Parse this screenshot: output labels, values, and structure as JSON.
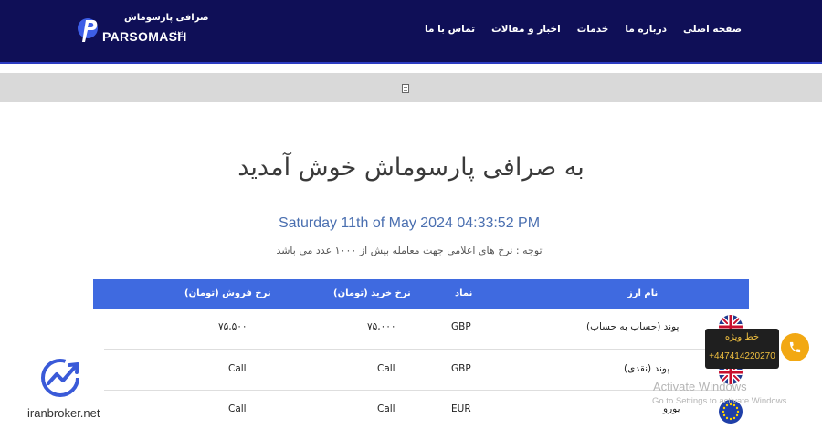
{
  "header": {
    "logo_sub": "صرافی پارسوماش",
    "logo_name": "PARSOMASH",
    "logo_tm": "Ltd",
    "nav": [
      "صفحه اصلی",
      "درباره ما",
      "خدمات",
      "اخبار و مقالات",
      "تماس با ما"
    ]
  },
  "main": {
    "welcome": "به صرافی پارسوماش خوش آمدید",
    "datetime": "Saturday 11th of May 2024 04:33:52 PM",
    "notice": "توجه : نرخ های اعلامی جهت معامله بیش از ۱۰۰۰ عدد می باشد"
  },
  "table": {
    "headers": {
      "name": "نام ارز",
      "symbol": "نماد",
      "buy": "نرخ خرید (تومان)",
      "sell": "نرخ فروش (تومان)"
    },
    "rows": [
      {
        "name": "پوند (حساب به حساب)",
        "symbol": "GBP",
        "buy": "۷۵,۰۰۰",
        "sell": "۷۵,۵۰۰",
        "flag": "uk-flag"
      },
      {
        "name": "پوند (نقدی)",
        "symbol": "GBP",
        "buy": "Call",
        "sell": "Call",
        "flag": "uk-flag"
      },
      {
        "name": "یورو",
        "symbol": "EUR",
        "buy": "Call",
        "sell": "Call",
        "flag": "eu-flag"
      }
    ]
  },
  "call": {
    "title": "خط ویژه",
    "phone": "+447414220270"
  },
  "watermark": {
    "line1": "Activate Windows",
    "line2": "Go to Settings to activate Windows."
  },
  "badge": {
    "text": "iranbroker.net"
  },
  "colors": {
    "header_bg": "#0f0f57",
    "table_header": "#3f6ae0",
    "accent": "#f2a813"
  }
}
